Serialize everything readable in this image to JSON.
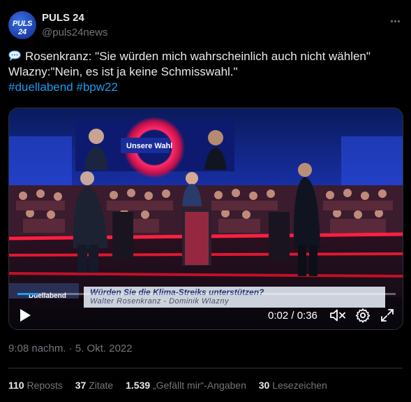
{
  "account": {
    "name": "PULS 24",
    "handle": "@puls24news",
    "avatar_text": "PULS 24"
  },
  "tweet": {
    "line1": "Rosenkranz: \"Sie würden mich wahrscheinlich auch nicht wählen\"",
    "line2": "Wlazny:\"Nein, es ist ja keine Schmisswahl.\"",
    "hashtag1": "#duellabend",
    "hashtag2": "#bpw22",
    "emoji_icon": "speech-balloon-icon"
  },
  "video": {
    "show_label": "Duellabend",
    "screen_title": "Unsere Wahl",
    "caption_question": "Würden Sie die Klima-Streiks unterstützen?",
    "caption_names": "Walter Rosenkranz  -  Dominik Wlazny",
    "time": "0:02 / 0:36",
    "progress_fraction": 0.055,
    "accent_color": "#1d9bf0"
  },
  "meta": {
    "timestamp": "9:08 nachm. · 5. Okt. 2022"
  },
  "stats": {
    "reposts_count": "110",
    "reposts_label": "Reposts",
    "quotes_count": "37",
    "quotes_label": "Zitate",
    "likes_count": "1.539",
    "likes_label": "„Gefällt mir“-Angaben",
    "bookmarks_count": "30",
    "bookmarks_label": "Lesezeichen"
  }
}
